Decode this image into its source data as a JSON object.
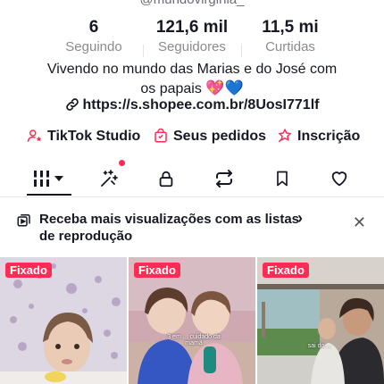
{
  "profile": {
    "username": "@mundovirginia_"
  },
  "stats": [
    {
      "value": "6",
      "label": "Seguindo"
    },
    {
      "value": "121,6 mil",
      "label": "Seguidores"
    },
    {
      "value": "11,5 mi",
      "label": "Curtidas"
    }
  ],
  "bio": {
    "line1": "Vivendo no mundo das Marias e do José com",
    "line2": "os papais",
    "hearts": "💖💙",
    "link": "https://s.shopee.com.br/8UosI771lf"
  },
  "actions": [
    {
      "label": "TikTok Studio",
      "icon": "person-star-icon"
    },
    {
      "label": "Seus pedidos",
      "icon": "shopping-bag-icon"
    },
    {
      "label": "Inscrição",
      "icon": "subscription-icon"
    }
  ],
  "tabs": [
    {
      "name": "videos-grid",
      "icon": "grid-dropdown-icon",
      "active": true
    },
    {
      "name": "reposts-sparkle",
      "icon": "sparkle-icon",
      "notification_dot": true
    },
    {
      "name": "private",
      "icon": "lock-icon"
    },
    {
      "name": "reposts",
      "icon": "repost-icon"
    },
    {
      "name": "favorites",
      "icon": "bookmark-icon"
    },
    {
      "name": "liked",
      "icon": "heart-icon"
    }
  ],
  "promo": {
    "text": "Receba mais visualizações com as listas de reprodução",
    "chevron": "›",
    "close": "✕"
  },
  "videos": [
    {
      "badge": "Fixado",
      "caption": ""
    },
    {
      "badge": "Fixado",
      "caption": "3 em ... cuidado da mamã"
    },
    {
      "badge": "Fixado",
      "caption": "sai do ..."
    }
  ],
  "colors": {
    "accent": "#fe2c55",
    "text": "#161823",
    "muted": "#8a8b91"
  }
}
